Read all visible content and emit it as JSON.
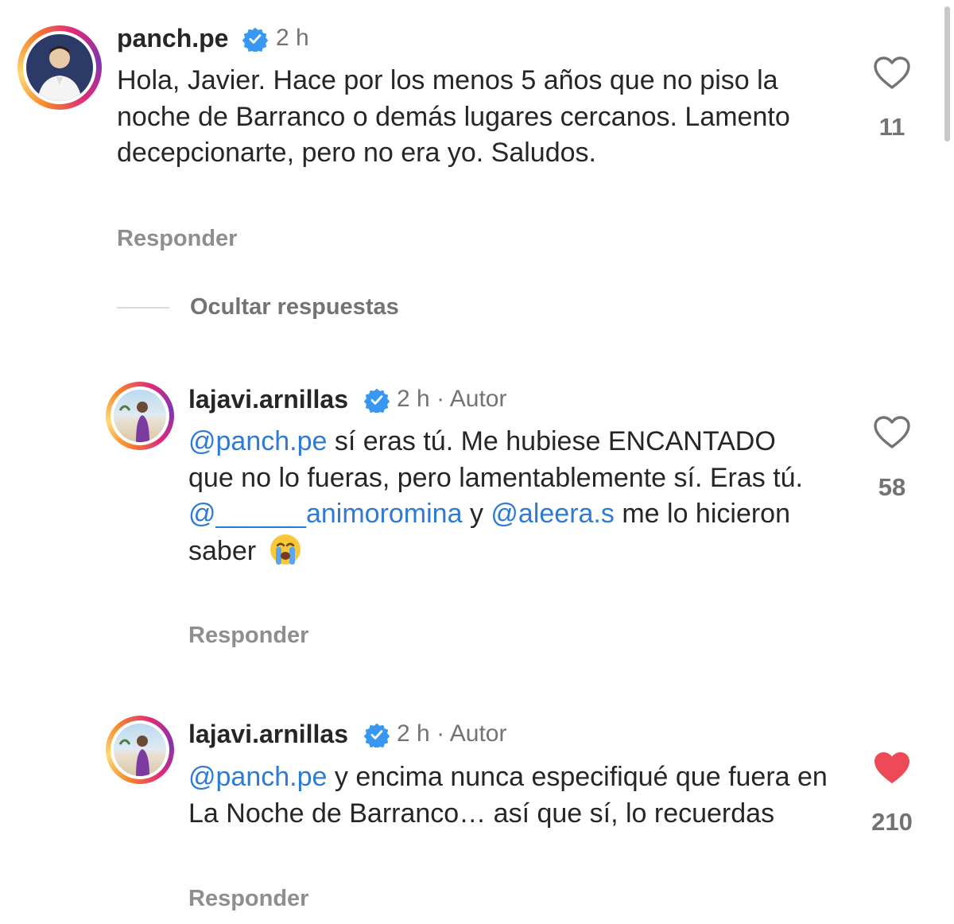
{
  "comments": [
    {
      "username": "panch.pe",
      "time": "2 h",
      "role": "",
      "text": "Hola, Javier. Hace por los menos 5 años que no piso la noche de Barranco o demás lugares cercanos. Lamento decepcionarte, pero no era yo. Saludos.",
      "reply_label": "Responder",
      "likes": "11",
      "liked": false
    },
    {
      "username": "lajavi.arnillas",
      "time": "2 h",
      "separator": "·",
      "role": "Autor",
      "mention1": "@panch.pe",
      "text_a": " sí eras tú. Me hubiese ENCANTADO que no lo fueras, pero lamentablemente sí. Eras tú.",
      "mention2": "@______animoromina",
      "text_b": " y ",
      "mention3": "@aleera.s",
      "text_c": " me lo hicieron saber",
      "reply_label": "Responder",
      "likes": "58",
      "liked": false
    },
    {
      "username": "lajavi.arnillas",
      "time": "2 h",
      "separator": "·",
      "role": "Autor",
      "mention1": "@panch.pe",
      "text_a": " y encima nunca especifiqué que fuera en La Noche de Barranco… así que sí, lo recuerdas",
      "reply_label": "Responder",
      "likes": "210",
      "liked": true
    }
  ],
  "hide_replies_label": "Ocultar respuestas",
  "colors": {
    "mention": "#2f7bd4",
    "verified": "#3897f0",
    "like_active": "#ed4956",
    "muted": "#737373"
  },
  "icons": [
    "verified-badge-icon",
    "heart-outline-icon",
    "heart-filled-icon",
    "crying-face-emoji"
  ]
}
